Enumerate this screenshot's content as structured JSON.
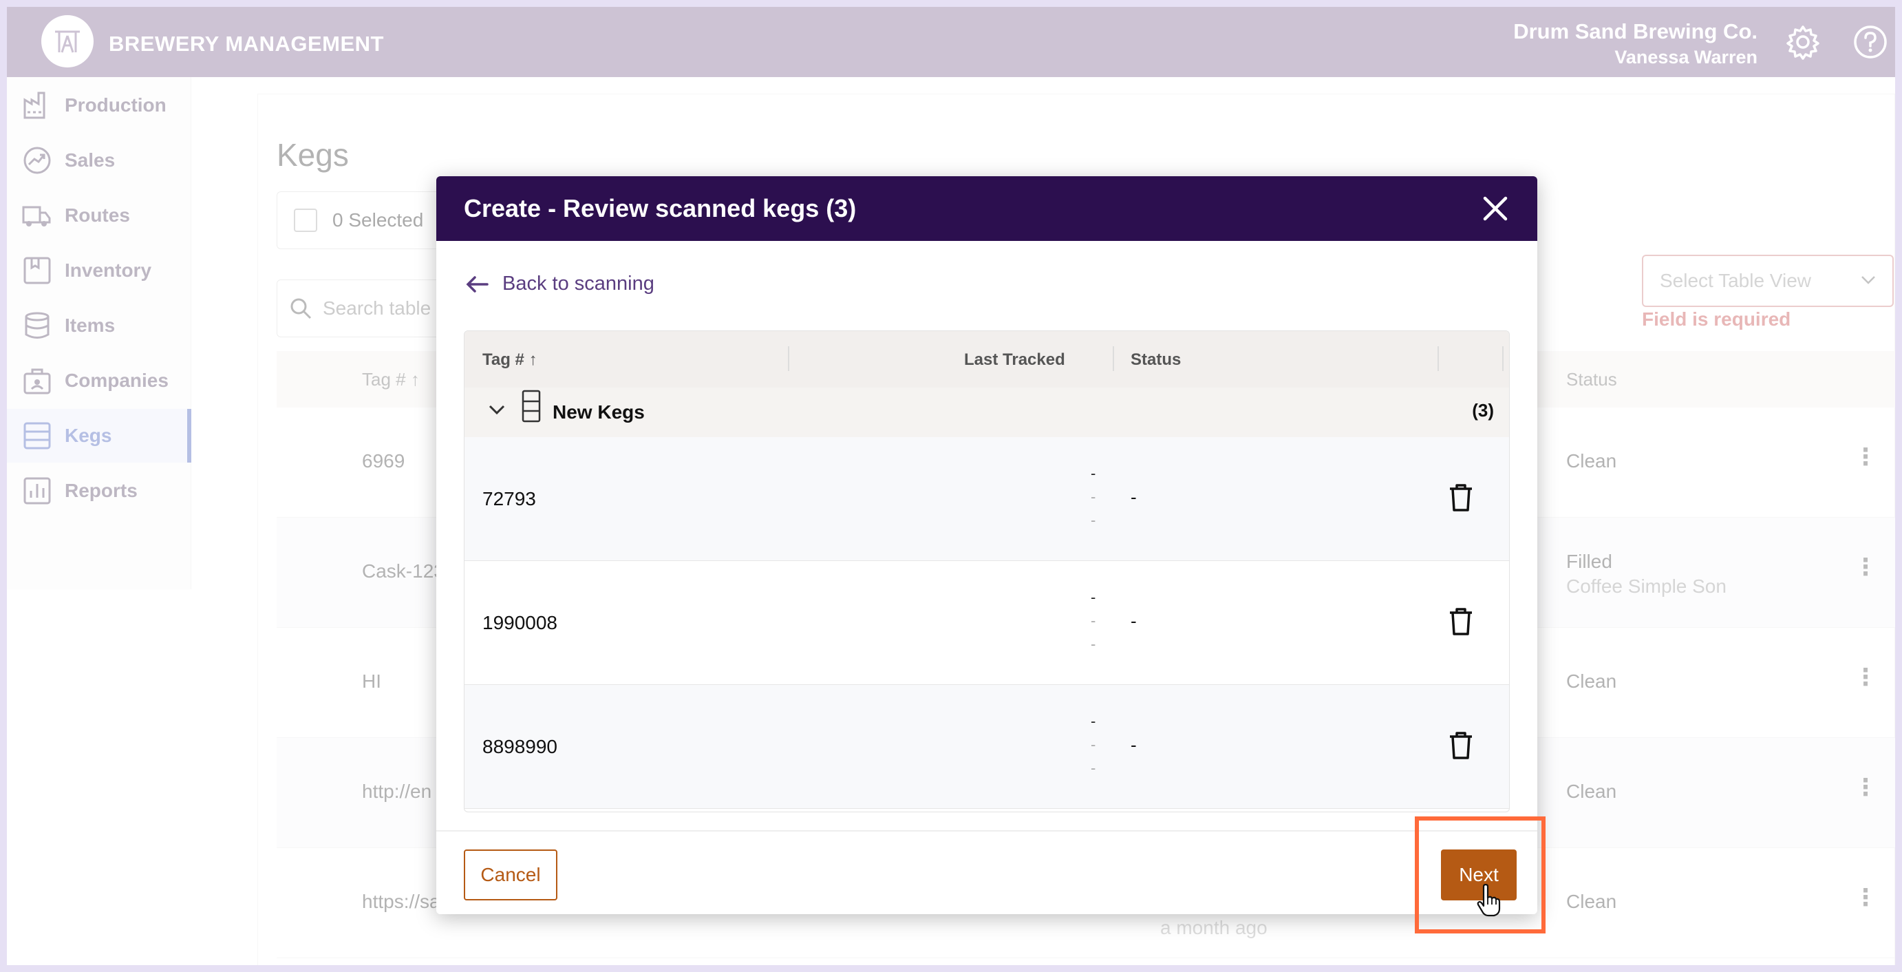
{
  "header": {
    "app_title": "BREWERY MANAGEMENT",
    "org_name": "Drum Sand Brewing Co.",
    "user_name": "Vanessa Warren"
  },
  "sidebar": {
    "items": [
      {
        "label": "Production",
        "icon": "factory-icon"
      },
      {
        "label": "Sales",
        "icon": "trend-up-icon"
      },
      {
        "label": "Routes",
        "icon": "truck-icon"
      },
      {
        "label": "Inventory",
        "icon": "inventory-icon"
      },
      {
        "label": "Items",
        "icon": "items-icon"
      },
      {
        "label": "Companies",
        "icon": "briefcase-icon"
      },
      {
        "label": "Kegs",
        "icon": "keg-icon",
        "active": true
      },
      {
        "label": "Reports",
        "icon": "bar-chart-icon"
      }
    ]
  },
  "page": {
    "title": "Kegs",
    "selected_label": "0 Selected",
    "search_placeholder": "Search table",
    "table_view_placeholder": "Select Table View",
    "table_view_error": "Field is required",
    "columns": {
      "tag": "Tag #",
      "status": "Status"
    },
    "rows": [
      {
        "tag": "6969",
        "status": "Clean",
        "sub": ""
      },
      {
        "tag": "Cask-123",
        "status": "Filled",
        "sub": "Coffee Simple Son"
      },
      {
        "tag": "HI",
        "status": "Clean",
        "sub": ""
      },
      {
        "tag": "http://en",
        "status": "Clean",
        "sub": ""
      },
      {
        "tag": "https://sa",
        "status": "Clean",
        "sub": ""
      }
    ],
    "partial_time": "a month ago"
  },
  "modal": {
    "title": "Create - Review scanned kegs (3)",
    "back_label": "Back to scanning",
    "columns": {
      "tag": "Tag #",
      "last_tracked": "Last Tracked",
      "status": "Status"
    },
    "group": {
      "label": "New Kegs",
      "count": "(3)"
    },
    "rows": [
      {
        "tag": "72793",
        "last_tracked": "-",
        "status": "-"
      },
      {
        "tag": "1990008",
        "last_tracked": "-",
        "status": "-"
      },
      {
        "tag": "8898990",
        "last_tracked": "-",
        "status": "-"
      }
    ],
    "cancel_label": "Cancel",
    "next_label": "Next"
  },
  "colors": {
    "header_bg": "#9a86a8",
    "modal_header_bg": "#2c0f4f",
    "accent_button": "#b55a14",
    "highlight": "#ff6a3a",
    "active_nav": "#6b7fc9"
  }
}
